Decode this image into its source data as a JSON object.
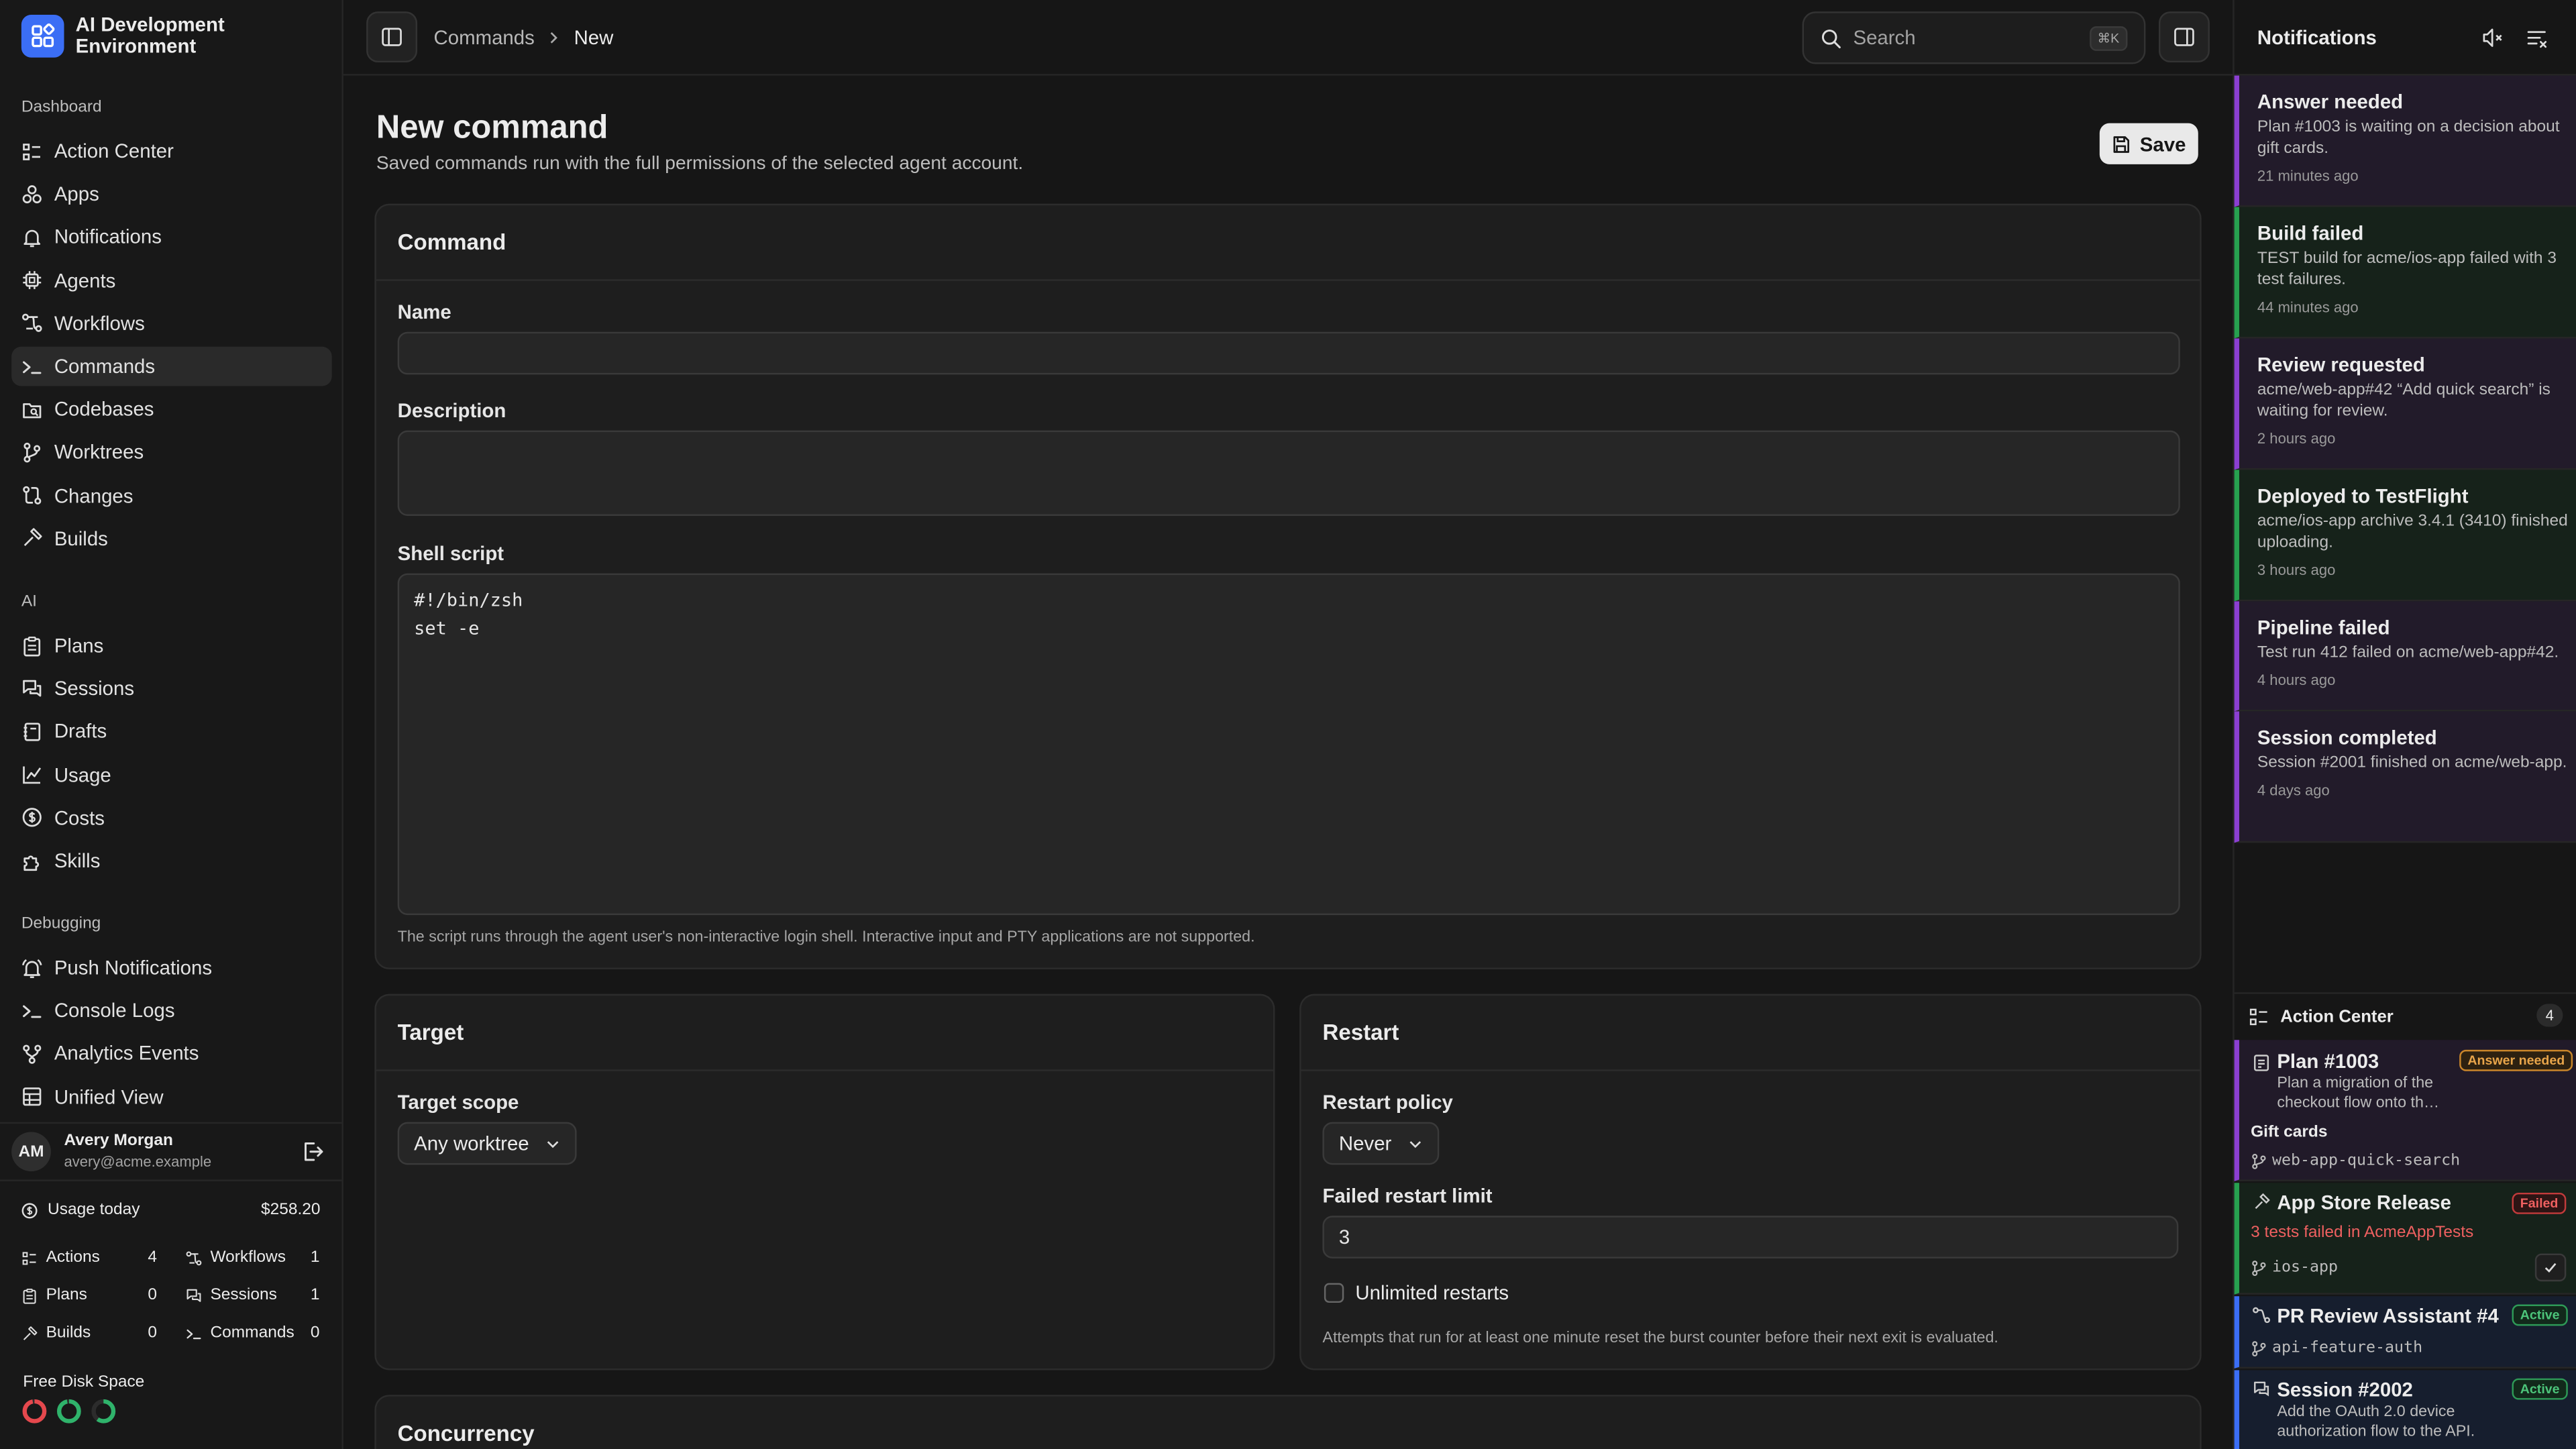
{
  "app": {
    "title": "AI Development Environment"
  },
  "sidebar": {
    "sections": {
      "dashboard": "Dashboard",
      "ai": "AI",
      "debugging": "Debugging"
    },
    "dashboard_items": [
      {
        "label": "Action Center",
        "icon": "checklist-icon"
      },
      {
        "label": "Apps",
        "icon": "apps-icon"
      },
      {
        "label": "Notifications",
        "icon": "bell-icon"
      },
      {
        "label": "Agents",
        "icon": "chip-icon"
      },
      {
        "label": "Workflows",
        "icon": "workflow-icon"
      },
      {
        "label": "Commands",
        "icon": "terminal-icon",
        "active": true
      },
      {
        "label": "Codebases",
        "icon": "folder-search-icon"
      },
      {
        "label": "Worktrees",
        "icon": "git-branch-icon"
      },
      {
        "label": "Changes",
        "icon": "git-compare-icon"
      },
      {
        "label": "Builds",
        "icon": "hammer-icon"
      }
    ],
    "ai_items": [
      {
        "label": "Plans",
        "icon": "clipboard-icon"
      },
      {
        "label": "Sessions",
        "icon": "chat-icon"
      },
      {
        "label": "Drafts",
        "icon": "notebook-icon"
      },
      {
        "label": "Usage",
        "icon": "chart-icon"
      },
      {
        "label": "Costs",
        "icon": "dollar-circle-icon"
      },
      {
        "label": "Skills",
        "icon": "puzzle-icon"
      }
    ],
    "debugging_items": [
      {
        "label": "Push Notifications",
        "icon": "bell-ring-icon"
      },
      {
        "label": "Console Logs",
        "icon": "terminal-icon"
      },
      {
        "label": "Analytics Events",
        "icon": "branch-icon"
      },
      {
        "label": "Unified View",
        "icon": "table-icon"
      }
    ],
    "user": {
      "initials": "AM",
      "name": "Avery Morgan",
      "email": "avery@acme.example"
    },
    "usage": {
      "label": "Usage today",
      "value": "$258.20"
    },
    "stats": [
      {
        "label": "Actions",
        "value": "4"
      },
      {
        "label": "Workflows",
        "value": "1"
      },
      {
        "label": "Plans",
        "value": "0"
      },
      {
        "label": "Sessions",
        "value": "1"
      },
      {
        "label": "Builds",
        "value": "0"
      },
      {
        "label": "Commands",
        "value": "0"
      }
    ],
    "disk": {
      "label": "Free Disk Space",
      "rings": [
        {
          "color": "#e5484d",
          "level": 0.97
        },
        {
          "color": "#2fb36b",
          "level": 0.97
        },
        {
          "color": "#2fb36b",
          "level": 0.6
        }
      ]
    }
  },
  "topbar": {
    "breadcrumb": [
      "Commands",
      "New"
    ],
    "search": {
      "placeholder": "Search",
      "shortcut": "⌘K"
    }
  },
  "page": {
    "title": "New command",
    "subtitle": "Saved commands run with the full permissions of the selected agent account.",
    "save_label": "Save"
  },
  "command_card": {
    "title": "Command",
    "name_label": "Name",
    "name_value": "",
    "description_label": "Description",
    "description_value": "",
    "script_label": "Shell script",
    "script_value": "#!/bin/zsh\nset -e",
    "script_help": "The script runs through the agent user's non-interactive login shell. Interactive input and PTY applications are not supported."
  },
  "target_card": {
    "title": "Target",
    "scope_label": "Target scope",
    "scope_value": "Any worktree"
  },
  "restart_card": {
    "title": "Restart",
    "policy_label": "Restart policy",
    "policy_value": "Never",
    "limit_label": "Failed restart limit",
    "limit_value": "3",
    "unlimited_label": "Unlimited restarts",
    "unlimited_checked": false,
    "help": "Attempts that run for at least one minute reset the burst counter before their next exit is evaluated."
  },
  "concurrency_card": {
    "title": "Concurrency"
  },
  "notifications": {
    "title": "Notifications",
    "items": [
      {
        "title": "Answer needed",
        "body": "Plan #1003 is waiting on a decision about gift cards.",
        "time": "21 minutes ago",
        "color": "purple"
      },
      {
        "title": "Build failed",
        "body": "TEST build for acme/ios-app failed with 3 test failures.",
        "time": "44 minutes ago",
        "color": "green"
      },
      {
        "title": "Review requested",
        "body": "acme/web-app#42 “Add quick search” is waiting for review.",
        "time": "2 hours ago",
        "color": "purple"
      },
      {
        "title": "Deployed to TestFlight",
        "body": "acme/ios-app archive 3.4.1 (3410) finished uploading.",
        "time": "3 hours ago",
        "color": "green"
      },
      {
        "title": "Pipeline failed",
        "body": "Test run 412 failed on acme/web-app#42.",
        "time": "4 hours ago",
        "color": "purple"
      },
      {
        "title": "Session completed",
        "body": "Session #2001 finished on acme/web-app.",
        "time": "4 days ago",
        "color": "purple"
      }
    ]
  },
  "action_center": {
    "title": "Action Center",
    "count": "4",
    "items": [
      {
        "title": "Plan #1003",
        "badge": "Answer needed",
        "body": "Plan a migration of the checkout flow onto th…",
        "extra": "Gift cards",
        "branch": "web-app-quick-search"
      },
      {
        "title": "App Store Release",
        "badge": "Failed",
        "body": "3 tests failed in AcmeAppTests",
        "branch": "ios-app"
      },
      {
        "title": "PR Review Assistant #4…",
        "badge": "Active",
        "branch": "api-feature-auth"
      },
      {
        "title": "Session #2002",
        "badge": "Active",
        "body": "Add the OAuth 2.0 device authorization flow to the API."
      }
    ]
  }
}
